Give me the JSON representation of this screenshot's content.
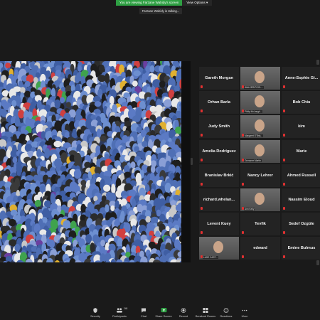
{
  "banner": {
    "message": "You are viewing Farzane Wahidy's screen",
    "view_options": "View Options ▾"
  },
  "speaker": {
    "talking": "Farzane Wahidy is talking..."
  },
  "gallery": {
    "tiles": [
      {
        "name": "Gareth Morgan",
        "video": false
      },
      {
        "name": "",
        "video": true,
        "label": "WALKER/POOL..."
      },
      {
        "name": "Anne-Sophie Gi...",
        "video": false
      },
      {
        "name": "Orhan Barla",
        "video": false
      },
      {
        "name": "",
        "video": true,
        "label": "Philip McLaugh..."
      },
      {
        "name": "Bob Chiu",
        "video": false
      },
      {
        "name": "Judy Smith",
        "video": false
      },
      {
        "name": "",
        "video": true,
        "label": "Margaret O'Bria..."
      },
      {
        "name": "kim",
        "video": false
      },
      {
        "name": "Amelia Rodriguez",
        "video": false
      },
      {
        "name": "",
        "video": true,
        "label": "Grossner Martin"
      },
      {
        "name": "Marie",
        "video": false
      },
      {
        "name": "Branislav Brkić",
        "video": false
      },
      {
        "name": "Nancy Lehrer",
        "video": false
      },
      {
        "name": "Ahmed Russell",
        "video": false
      },
      {
        "name": "richard.whelan...",
        "video": false
      },
      {
        "name": "",
        "video": true,
        "label": "Ann Kelly"
      },
      {
        "name": "Nassim Eloud",
        "video": false
      },
      {
        "name": "Levent Kuey",
        "video": false
      },
      {
        "name": "Tevfik",
        "video": false
      },
      {
        "name": "Sedef Özgüle",
        "video": false
      },
      {
        "name": "",
        "video": true,
        "label": "LASE CAST..."
      },
      {
        "name": "edward",
        "video": false
      },
      {
        "name": "Emine Bulmus",
        "video": false
      }
    ]
  },
  "toolbar": {
    "security": "Security",
    "participants": "Participants",
    "participants_count": "248",
    "chat": "Chat",
    "share_screen": "Share Screen",
    "record": "Record",
    "breakout_rooms": "Breakout Rooms",
    "reactions": "Reactions",
    "more": "More"
  },
  "colors": {
    "share_green": "#2ea043",
    "background": "#1a1a1a",
    "tile_bg": "#232323",
    "mic_muted_red": "#e03131",
    "crowd_blue": "#4f6fb5"
  }
}
